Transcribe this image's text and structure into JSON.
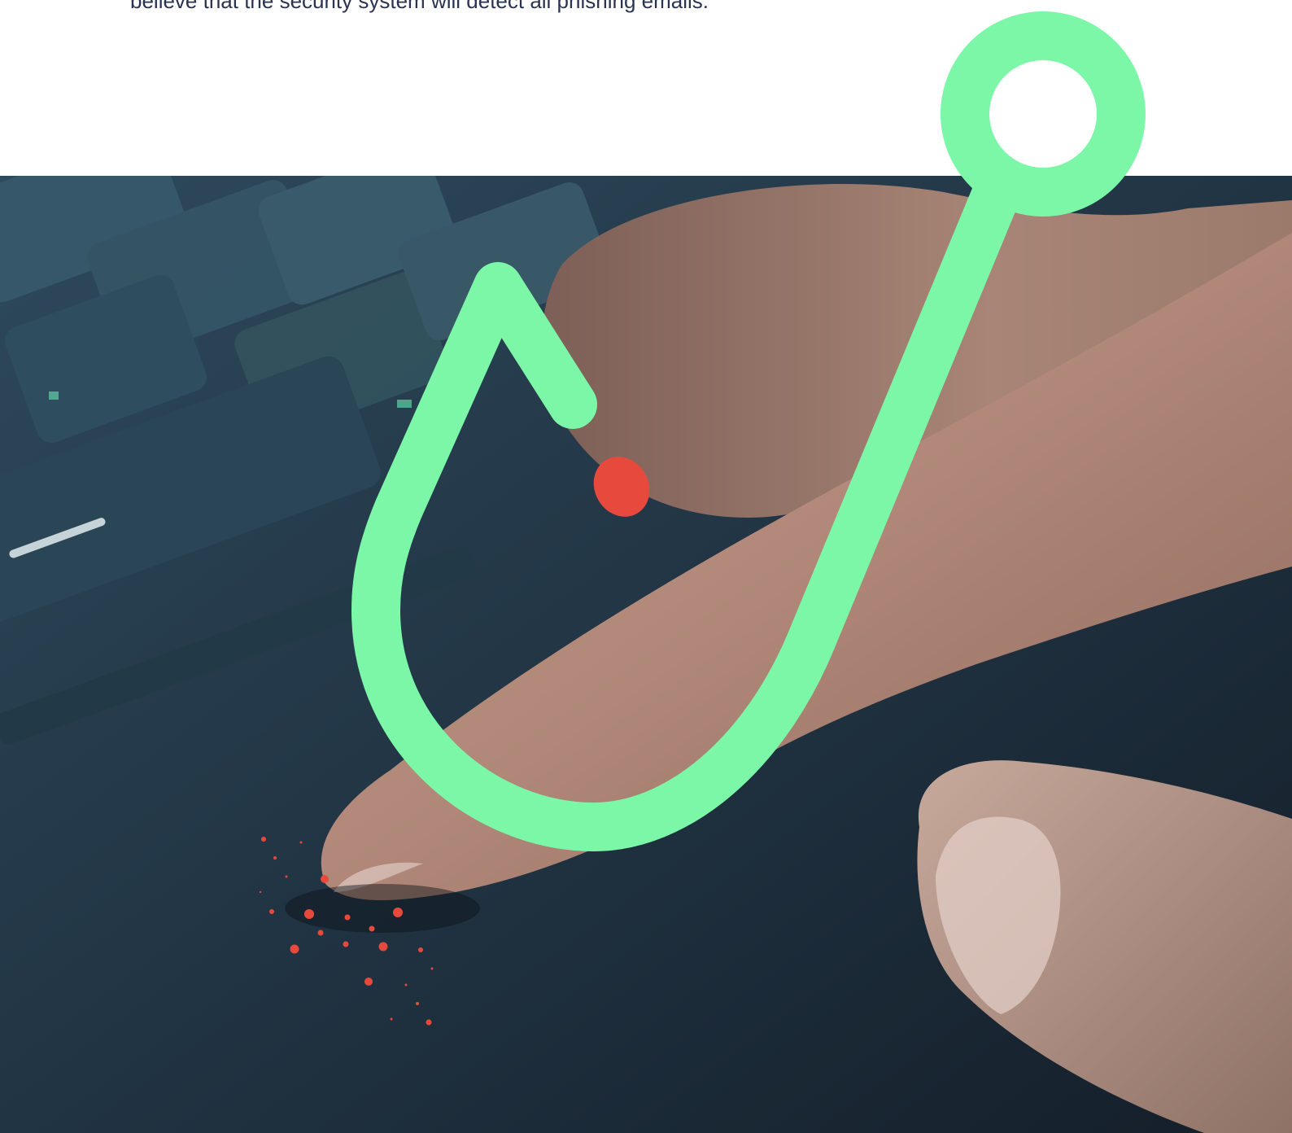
{
  "intro": {
    "text": "believe that the security system will detect all phishing emails."
  },
  "hero": {
    "image_description_icon": "finger-on-touchpad-photo",
    "hook_icon": "fishing-hook-icon",
    "hook_color": "#7cf7a8",
    "accent_color": "#e8493d"
  }
}
